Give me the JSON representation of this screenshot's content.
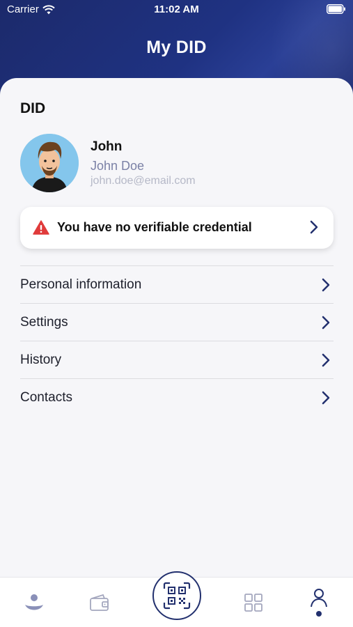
{
  "status_bar": {
    "carrier": "Carrier",
    "time": "11:02 AM"
  },
  "header": {
    "title": "My DID"
  },
  "did_section": {
    "title": "DID"
  },
  "profile": {
    "name": "John",
    "full_name": "John Doe",
    "email": "john.doe@email.com"
  },
  "alert": {
    "text": "You have no verifiable credential",
    "icon": "warning-icon",
    "color": "#e03b3b"
  },
  "menu": {
    "items": [
      {
        "label": "Personal information"
      },
      {
        "label": "Settings"
      },
      {
        "label": "History"
      },
      {
        "label": "Contacts"
      }
    ]
  },
  "tabbar": {
    "items": [
      {
        "icon": "home-icon"
      },
      {
        "icon": "wallet-icon"
      },
      {
        "icon": "qr-scan-icon"
      },
      {
        "icon": "grid-icon"
      },
      {
        "icon": "profile-icon",
        "active": true
      }
    ]
  },
  "colors": {
    "brand_navy": "#1f3282",
    "background": "#f6f6f9",
    "muted_text": "#7b81a6"
  }
}
